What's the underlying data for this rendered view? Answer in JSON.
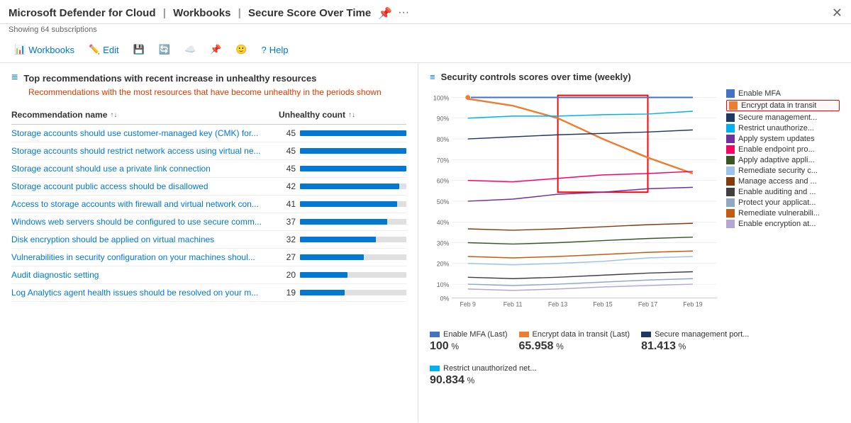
{
  "title": {
    "app": "Microsoft Defender for Cloud",
    "sep1": "|",
    "section": "Workbooks",
    "sep2": "|",
    "page": "Secure Score Over Time",
    "subtitle": "Showing 64 subscriptions"
  },
  "toolbar": {
    "items": [
      {
        "label": "Workbooks",
        "icon": "📊"
      },
      {
        "label": "Edit",
        "icon": "✏️"
      },
      {
        "label": "💾",
        "icon": "💾"
      },
      {
        "label": "🔄",
        "icon": "🔄"
      },
      {
        "label": "☁️",
        "icon": "☁️"
      },
      {
        "label": "📌",
        "icon": "📌"
      },
      {
        "label": "🙂",
        "icon": "🙂"
      },
      {
        "label": "?",
        "icon": "?"
      },
      {
        "label": "Help",
        "icon": ""
      }
    ]
  },
  "left": {
    "section_icon": "≡",
    "section_title": "Top recommendations with recent increase in unhealthy resources",
    "section_desc_part1": "Recommendations with the most resources that have become ",
    "section_desc_highlight": "unhealthy",
    "section_desc_part2": " in the periods shown",
    "table": {
      "col_name": "Recommendation name",
      "col_count": "Unhealthy count",
      "max_value": 45,
      "rows": [
        {
          "name": "Storage accounts should use customer-managed key (CMK) for...",
          "count": 45
        },
        {
          "name": "Storage accounts should restrict network access using virtual ne...",
          "count": 45
        },
        {
          "name": "Storage account should use a private link connection",
          "count": 45
        },
        {
          "name": "Storage account public access should be disallowed",
          "count": 42
        },
        {
          "name": "Access to storage accounts with firewall and virtual network con...",
          "count": 41
        },
        {
          "name": "Windows web servers should be configured to use secure comm...",
          "count": 37
        },
        {
          "name": "Disk encryption should be applied on virtual machines",
          "count": 32
        },
        {
          "name": "Vulnerabilities in security configuration on your machines shoul...",
          "count": 27
        },
        {
          "name": "Audit diagnostic setting",
          "count": 20
        },
        {
          "name": "Log Analytics agent health issues should be resolved on your m...",
          "count": 19
        }
      ]
    }
  },
  "right": {
    "section_title": "Security controls scores over time (weekly)",
    "legend": [
      {
        "label": "Enable MFA",
        "color": "#4472C4",
        "highlighted": false
      },
      {
        "label": "Encrypt data in transit",
        "color": "#ED7D31",
        "highlighted": true
      },
      {
        "label": "Secure management...",
        "color": "#203864",
        "highlighted": false
      },
      {
        "label": "Restrict unauthorize...",
        "color": "#00B0F0",
        "highlighted": false
      },
      {
        "label": "Apply system updates",
        "color": "#7030A0",
        "highlighted": false
      },
      {
        "label": "Enable endpoint pro...",
        "color": "#FF0066",
        "highlighted": false
      },
      {
        "label": "Apply adaptive appli...",
        "color": "#375623",
        "highlighted": false
      },
      {
        "label": "Remediate security c...",
        "color": "#9DC3E6",
        "highlighted": false
      },
      {
        "label": "Manage access and ...",
        "color": "#843C0C",
        "highlighted": false
      },
      {
        "label": "Enable auditing and ...",
        "color": "#404040",
        "highlighted": false
      },
      {
        "label": "Protect your applicat...",
        "color": "#8EA9C1",
        "highlighted": false
      },
      {
        "label": "Remediate vulnerabili...",
        "color": "#C55A11",
        "highlighted": false
      },
      {
        "label": "Enable encryption at...",
        "color": "#B4A7D6",
        "highlighted": false
      }
    ],
    "x_labels": [
      "Feb 9",
      "Feb 11",
      "Feb 13",
      "Feb 15",
      "Feb 17",
      "Feb 19"
    ],
    "y_labels": [
      "100%",
      "90%",
      "80%",
      "70%",
      "60%",
      "50%",
      "40%",
      "30%",
      "20%",
      "10%",
      "0%"
    ],
    "footer": [
      {
        "label": "Enable MFA (Last)",
        "color": "#4472C4",
        "value": "100",
        "unit": "%"
      },
      {
        "label": "Encrypt data in transit (Last)",
        "color": "#ED7D31",
        "value": "65.958",
        "unit": "%"
      },
      {
        "label": "Secure management port...",
        "color": "#203864",
        "value": "81.413",
        "unit": "%"
      },
      {
        "label": "Restrict unauthorized net...",
        "color": "#00B0F0",
        "value": "90.834",
        "unit": "%"
      }
    ]
  }
}
